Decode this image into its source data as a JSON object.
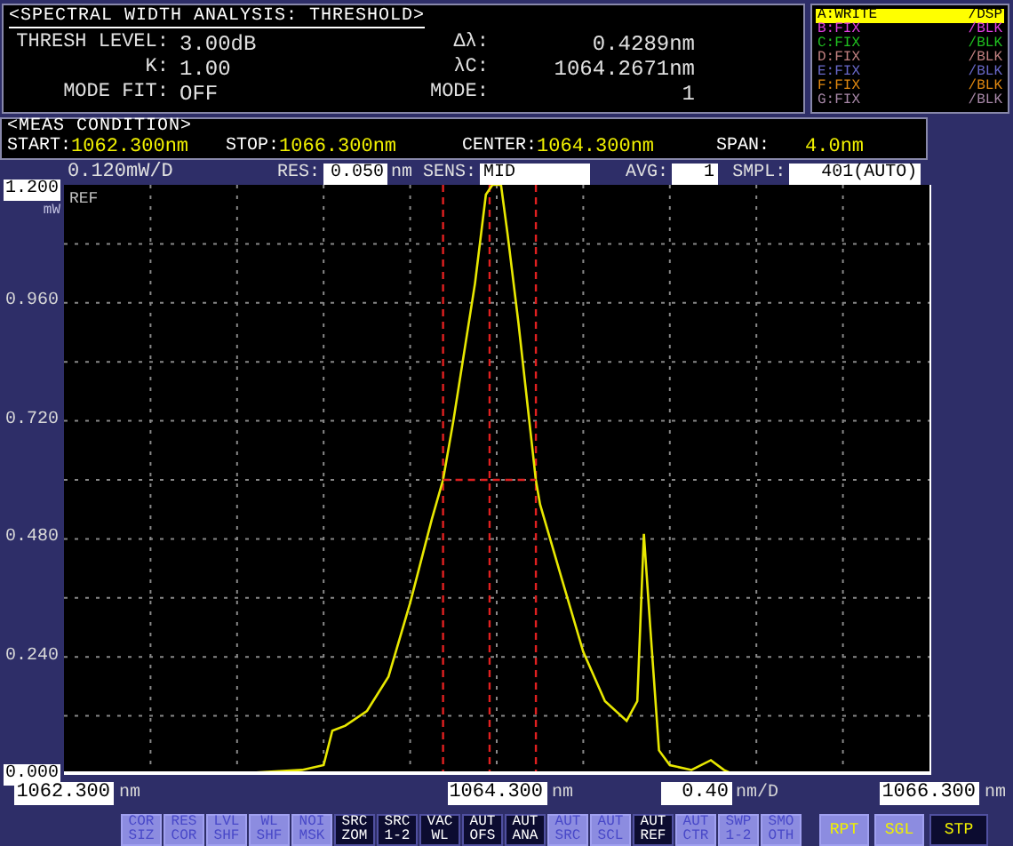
{
  "analysis": {
    "title": "<SPECTRAL WIDTH ANALYSIS: THRESHOLD>",
    "fields": [
      {
        "label": "THRESH LEVEL:",
        "value": "3.00dB"
      },
      {
        "label": "Δλ:",
        "value": "0.4289nm"
      },
      {
        "label": "K:",
        "value": "1.00"
      },
      {
        "label": "λC:",
        "value": "1064.2671nm"
      },
      {
        "label": "MODE FIT:",
        "value": "OFF"
      },
      {
        "label": "MODE:",
        "value": "1"
      }
    ]
  },
  "traces": [
    {
      "label": "A:WRITE",
      "state": "/DSP",
      "color": "#ffff00",
      "selected": true
    },
    {
      "label": "B:FIX",
      "state": "/BLK",
      "color": "#e040e0",
      "selected": false
    },
    {
      "label": "C:FIX",
      "state": "/BLK",
      "color": "#20c020",
      "selected": false
    },
    {
      "label": "D:FIX",
      "state": "/BLK",
      "color": "#c08080",
      "selected": false
    },
    {
      "label": "E:FIX",
      "state": "/BLK",
      "color": "#6868c8",
      "selected": false
    },
    {
      "label": "F:FIX",
      "state": "/BLK",
      "color": "#e08810",
      "selected": false
    },
    {
      "label": "G:FIX",
      "state": "/BLK",
      "color": "#a888a8",
      "selected": false
    }
  ],
  "meas_condition": {
    "title": "<MEAS CONDITION>",
    "items": [
      {
        "label": "START:",
        "value": "1062.300nm"
      },
      {
        "label": "STOP:",
        "value": "1066.300nm"
      },
      {
        "label": "CENTER:",
        "value": "1064.300nm"
      },
      {
        "label": "SPAN:",
        "value": "4.0nm"
      }
    ]
  },
  "settings": {
    "scale": "0.120mW/D",
    "items": [
      {
        "label": "RES:",
        "value": "0.050",
        "unit": "nm"
      },
      {
        "label": "SENS:",
        "value": "MID"
      },
      {
        "label": "AVG:",
        "value": "1"
      },
      {
        "label": "SMPL:",
        "value": "401(AUTO)"
      }
    ]
  },
  "plot": {
    "unit": "mW",
    "ref_label": "REF",
    "chart_data": {
      "type": "line",
      "xlim": [
        1062.3,
        1066.3
      ],
      "ylim": [
        0,
        1.2
      ],
      "yticks": [
        {
          "value": 1.2,
          "label": "1.200"
        },
        {
          "value": 0.96,
          "label": "0.960"
        },
        {
          "value": 0.72,
          "label": "0.720"
        },
        {
          "value": 0.48,
          "label": "0.480"
        },
        {
          "value": 0.24,
          "label": "0.240"
        },
        {
          "value": 0,
          "label": "0.000"
        }
      ],
      "xticks": [
        {
          "value": 1062.3,
          "label": "1062.300"
        },
        {
          "value": 1064.3,
          "label": "1064.300"
        },
        {
          "value": 1066.3,
          "label": "1066.300"
        }
      ],
      "x": [
        1062.3,
        1063.0,
        1063.4,
        1063.5,
        1063.54,
        1063.6,
        1063.7,
        1063.8,
        1063.9,
        1064.0,
        1064.052,
        1064.1,
        1064.2,
        1064.25,
        1064.28,
        1064.32,
        1064.35,
        1064.4,
        1064.481,
        1064.5,
        1064.6,
        1064.7,
        1064.8,
        1064.9,
        1064.95,
        1064.98,
        1065.01,
        1065.05,
        1065.1,
        1065.2,
        1065.29,
        1065.35,
        1065.4,
        1066.3
      ],
      "series": [
        {
          "color": "#e8e800",
          "values": [
            0,
            0,
            0.01,
            0.02,
            0.09,
            0.1,
            0.13,
            0.2,
            0.35,
            0.52,
            0.6,
            0.72,
            1.0,
            1.18,
            1.2,
            1.2,
            1.1,
            0.92,
            0.6,
            0.55,
            0.4,
            0.25,
            0.15,
            0.11,
            0.15,
            0.49,
            0.3,
            0.05,
            0.02,
            0.01,
            0.03,
            0.01,
            0,
            0
          ]
        },
        {
          "color": "#e02020",
          "line_style": "dashed",
          "values": [
            null,
            null,
            null,
            null,
            null,
            null,
            null,
            null,
            null,
            null,
            0.6,
            null,
            null,
            null,
            null,
            null,
            null,
            null,
            0.6,
            null,
            null,
            null,
            null,
            null,
            null,
            null,
            null,
            null,
            null,
            null,
            null,
            null,
            null,
            null
          ]
        }
      ],
      "grid": true,
      "ref_lines": [
        {
          "axis": "x",
          "value": 1064.052
        },
        {
          "axis": "x",
          "value": 1064.267
        },
        {
          "axis": "x",
          "value": 1064.481
        }
      ]
    },
    "scale_x": {
      "value": "0.40",
      "unit": "nm/D"
    },
    "x_units": [
      "nm",
      "nm",
      "nm"
    ]
  },
  "softkeys": [
    {
      "lines": [
        "COR",
        "SIZ"
      ],
      "on": false
    },
    {
      "lines": [
        "RES",
        "COR"
      ],
      "on": false
    },
    {
      "lines": [
        "LVL",
        "SHF"
      ],
      "on": false
    },
    {
      "lines": [
        "WL",
        "SHF"
      ],
      "on": false
    },
    {
      "lines": [
        "NOI",
        "MSK"
      ],
      "on": false
    },
    {
      "lines": [
        "SRC",
        "ZOM"
      ],
      "on": true
    },
    {
      "lines": [
        "SRC",
        "1-2"
      ],
      "on": true
    },
    {
      "lines": [
        "VAC",
        "WL"
      ],
      "on": true
    },
    {
      "lines": [
        "AUT",
        "OFS"
      ],
      "on": true
    },
    {
      "lines": [
        "AUT",
        "ANA"
      ],
      "on": true
    },
    {
      "lines": [
        "AUT",
        "SRC"
      ],
      "on": false
    },
    {
      "lines": [
        "AUT",
        "SCL"
      ],
      "on": false
    },
    {
      "lines": [
        "AUT",
        "REF"
      ],
      "on": true
    },
    {
      "lines": [
        "AUT",
        "CTR"
      ],
      "on": false
    },
    {
      "lines": [
        "SWP",
        "1-2"
      ],
      "on": false
    },
    {
      "lines": [
        "SMO",
        "OTH"
      ],
      "on": false
    }
  ],
  "sweep_buttons": [
    {
      "label": "RPT",
      "selected": false
    },
    {
      "label": "SGL",
      "selected": false
    },
    {
      "label": "STP",
      "selected": true
    }
  ]
}
